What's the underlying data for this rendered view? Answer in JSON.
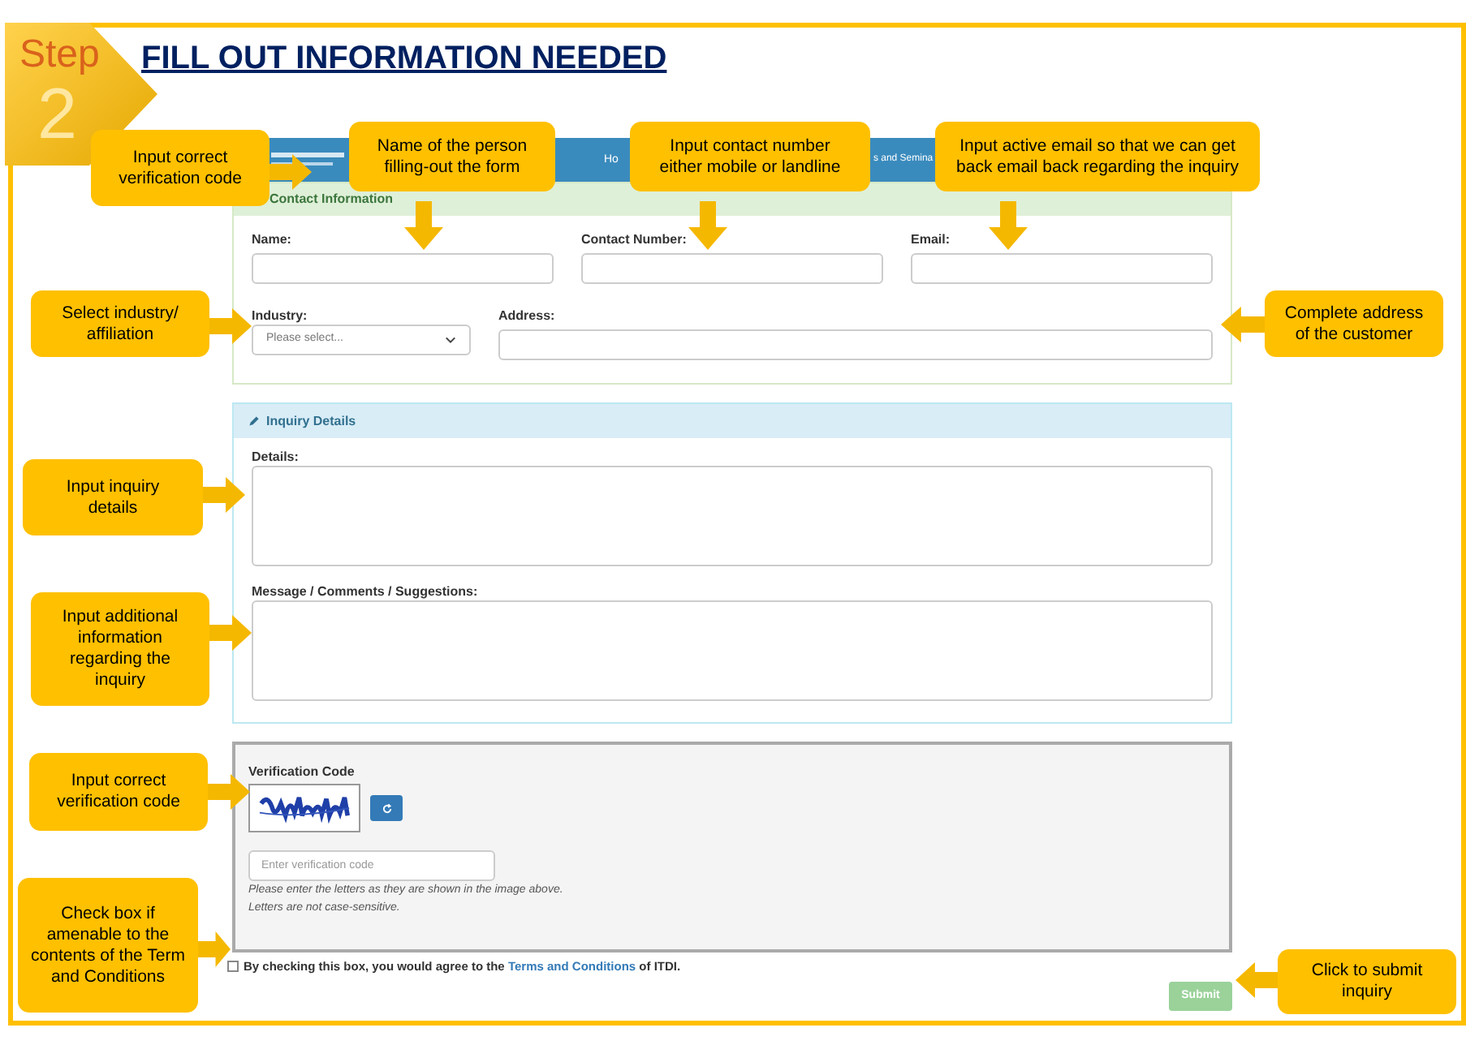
{
  "step_badge": {
    "word": "Step",
    "number": "2"
  },
  "title": "FILL OUT INFORMATION NEEDED",
  "site_header": {
    "nav_fragments": [
      "Ho",
      "s and Semina"
    ]
  },
  "contact_panel": {
    "heading": "Contact Information",
    "fields": [
      {
        "label": "Name:",
        "kind": "text"
      },
      {
        "label": "Contact Number:",
        "kind": "text"
      },
      {
        "label": "Email:",
        "kind": "text"
      },
      {
        "label": "Industry:",
        "kind": "select",
        "placeholder": "Please select..."
      },
      {
        "label": "Address:",
        "kind": "text"
      }
    ]
  },
  "inquiry_panel": {
    "heading": "Inquiry Details",
    "fields": [
      {
        "label": "Details:",
        "kind": "textarea"
      },
      {
        "label": "Message / Comments / Suggestions:",
        "kind": "textarea"
      }
    ]
  },
  "verification": {
    "label": "Verification Code",
    "placeholder": "Enter verification code",
    "help": [
      "Please enter the letters as they are shown in the image above.",
      "Letters are not case-sensitive."
    ]
  },
  "agreement": {
    "checked": false,
    "text_before": "By checking this box, you would agree to the",
    "link": "Terms and Conditions",
    "text_after": "of ITDI."
  },
  "submit": {
    "label": "Submit",
    "disabled": true
  },
  "callouts": [
    {
      "text": "Input correct verification code",
      "kind": "right"
    },
    {
      "text": "Name of the person filling-out the form",
      "kind": "down"
    },
    {
      "text": "Input contact number either mobile or landline",
      "kind": "down"
    },
    {
      "text": "Input active email so that we can get back email back regarding the inquiry",
      "kind": "down"
    },
    {
      "text": "Select industry/ affiliation",
      "kind": "right"
    },
    {
      "text": "Complete address of the customer",
      "kind": "left"
    },
    {
      "text": "Input inquiry details",
      "kind": "right"
    },
    {
      "text": "Input additional information regarding the inquiry",
      "kind": "right"
    },
    {
      "text": "Input correct verification code",
      "kind": "right"
    },
    {
      "text": "Check box if amenable to the contents of the Term and Conditions",
      "kind": "right"
    },
    {
      "text": "Click to submit inquiry",
      "kind": "left"
    }
  ]
}
